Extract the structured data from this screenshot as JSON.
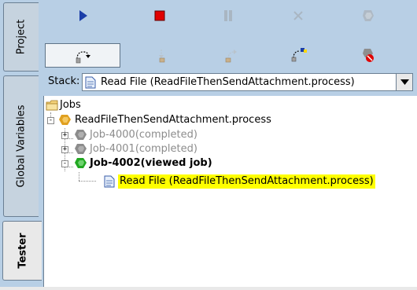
{
  "side_tabs": [
    {
      "label": "Project",
      "active": false
    },
    {
      "label": "Global Variables",
      "active": false
    },
    {
      "label": "Tester",
      "active": true
    }
  ],
  "toolbar": {
    "row1": [
      {
        "icon": "play-icon",
        "color": "#1b3ea8"
      },
      {
        "icon": "stop-icon",
        "color": "#e00000"
      },
      {
        "icon": "pause-icon",
        "color": "#a9b6c2"
      },
      {
        "icon": "close-icon",
        "color": "#a9b6c2"
      },
      {
        "icon": "process-icon",
        "color": "#aeb9c4"
      }
    ],
    "row2": [
      {
        "icon": "step-into-icon",
        "selected": true
      },
      {
        "icon": "step-icon"
      },
      {
        "icon": "step-out-icon"
      },
      {
        "icon": "breakpoint-icon"
      },
      {
        "icon": "remove-process-icon"
      }
    ]
  },
  "stack": {
    "label": "Stack:",
    "value": "Read File (ReadFileThenSendAttachment.process)"
  },
  "tree": {
    "root": {
      "label": "Jobs",
      "icon": "folder-icon"
    },
    "process": {
      "label": "ReadFileThenSendAttachment.process",
      "icon": "process-icon"
    },
    "jobs": [
      {
        "label": "Job-4000(completed)",
        "style": "gray",
        "toggle": "+"
      },
      {
        "label": "Job-4001(completed)",
        "style": "gray",
        "toggle": "+"
      },
      {
        "label": "Job-4002(viewed job)",
        "style": "bold",
        "toggle": "-"
      }
    ],
    "activity": {
      "label": "Read File (ReadFileThenSendAttachment.process)",
      "icon": "document-icon"
    }
  },
  "colors": {
    "panel_bg": "#b8cfe5",
    "highlight": "#ffff00",
    "accent_blue": "#1b3ea8",
    "stop_red": "#e00000",
    "job_active_green": "#22a822",
    "process_gold": "#e0a020"
  }
}
